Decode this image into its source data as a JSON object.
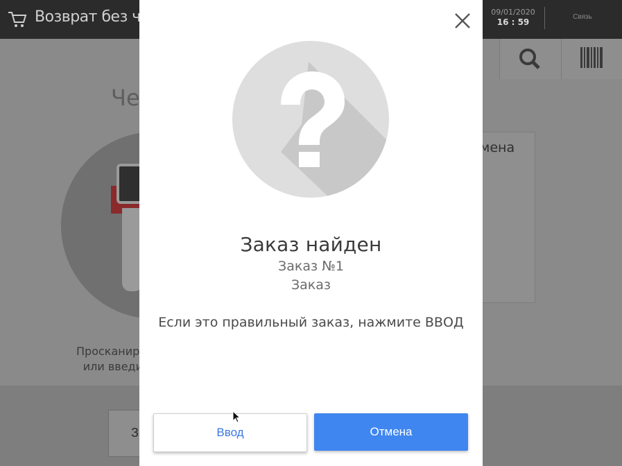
{
  "app": {
    "title": "Возврат без чек",
    "date": "09/01/2020",
    "time": "16 : 59",
    "link_label": "Связь"
  },
  "background": {
    "heading_partial": "Че",
    "instruction_line1": "Просканиру",
    "instruction_line2": "или введи",
    "card_label_partial": "мена",
    "button_partial": "З"
  },
  "modal": {
    "title": "Заказ найден",
    "order_number": "Заказ №1",
    "order_type": "Заказ",
    "message": "Если это правильный заказ, нажмите ВВОД",
    "enter_label": "Ввод",
    "cancel_label": "Отмена"
  },
  "colors": {
    "primary": "#3f86f0",
    "primary_text": "#3a78e6",
    "topbar": "#2b2b2b"
  },
  "icons": [
    "cart-icon",
    "search-icon",
    "barcode-icon",
    "close-icon",
    "question-icon",
    "scanner-icon",
    "mouse-cursor-icon"
  ]
}
